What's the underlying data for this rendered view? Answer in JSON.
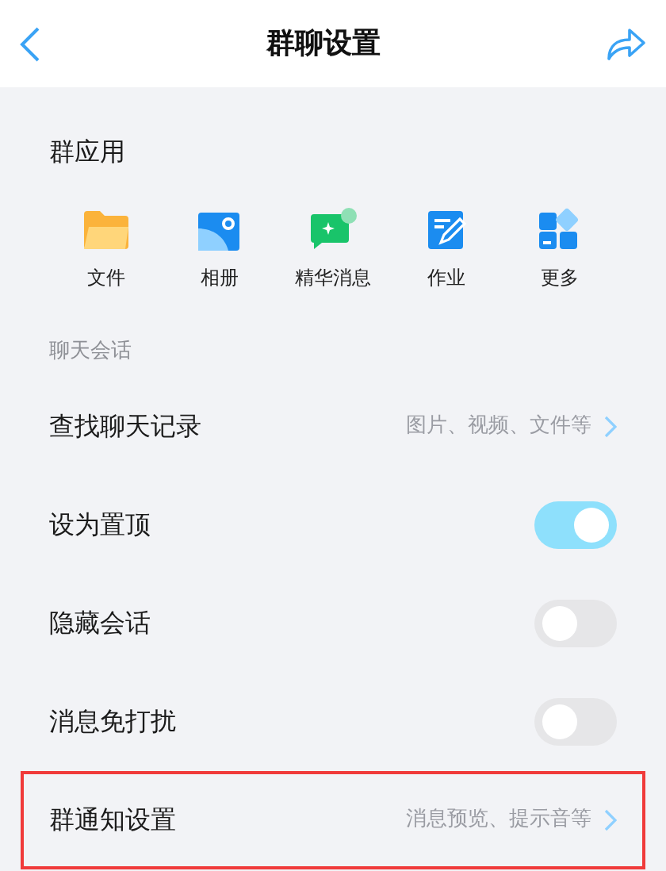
{
  "header": {
    "title": "群聊设置"
  },
  "group_apps": {
    "title": "群应用",
    "items": [
      {
        "label": "文件"
      },
      {
        "label": "相册"
      },
      {
        "label": "精华消息"
      },
      {
        "label": "作业"
      },
      {
        "label": "更多"
      }
    ]
  },
  "chat_section": {
    "title": "聊天会话",
    "rows": [
      {
        "kind": "link",
        "label": "查找聊天记录",
        "value": "图片、视频、文件等",
        "highlighted": false
      },
      {
        "kind": "switch",
        "label": "设为置顶",
        "on": true,
        "highlighted": false
      },
      {
        "kind": "switch",
        "label": "隐藏会话",
        "on": false,
        "highlighted": false
      },
      {
        "kind": "switch",
        "label": "消息免打扰",
        "on": false,
        "highlighted": false
      },
      {
        "kind": "link",
        "label": "群通知设置",
        "value": "消息预览、提示音等",
        "highlighted": true
      }
    ]
  }
}
